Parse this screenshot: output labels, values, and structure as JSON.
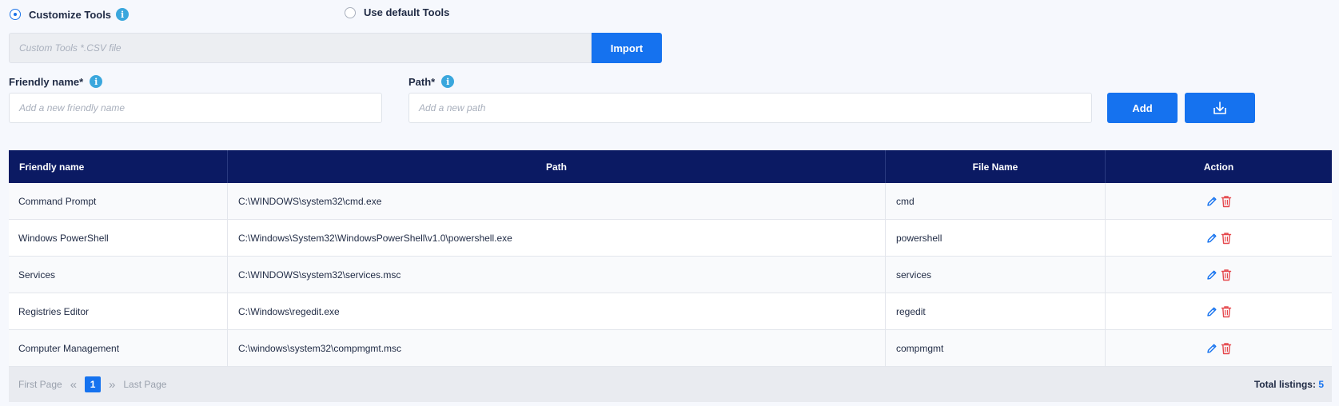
{
  "mode": {
    "customize_label": "Customize Tools",
    "default_label": "Use default Tools",
    "selected": "customize"
  },
  "import": {
    "placeholder": "Custom Tools *.CSV file",
    "button_label": "Import"
  },
  "form": {
    "friendly_label": "Friendly name*",
    "friendly_placeholder": "Add a new friendly name",
    "path_label": "Path*",
    "path_placeholder": "Add a new path",
    "add_label": "Add"
  },
  "table": {
    "headers": [
      "Friendly name",
      "Path",
      "File Name",
      "Action"
    ],
    "rows": [
      {
        "name": "Command Prompt",
        "path": "C:\\WINDOWS\\system32\\cmd.exe",
        "file": "cmd"
      },
      {
        "name": "Windows PowerShell",
        "path": "C:\\Windows\\System32\\WindowsPowerShell\\v1.0\\powershell.exe",
        "file": "powershell"
      },
      {
        "name": "Services",
        "path": "C:\\WINDOWS\\system32\\services.msc",
        "file": "services"
      },
      {
        "name": "Registries Editor",
        "path": "C:\\Windows\\regedit.exe",
        "file": "regedit"
      },
      {
        "name": "Computer Management",
        "path": "C:\\windows\\system32\\compmgmt.msc",
        "file": "compmgmt"
      }
    ]
  },
  "pager": {
    "first_label": "First Page",
    "current_page": "1",
    "last_label": "Last Page",
    "total_label": "Total listings:",
    "total_count": "5"
  },
  "colors": {
    "accent": "#1572ef",
    "header_bg": "#0b1a63",
    "delete": "#e5484d",
    "info": "#3aa7dd"
  },
  "icons": [
    "info-icon",
    "edit-icon",
    "trash-icon",
    "download-icon",
    "chevron-double-left-icon",
    "chevron-double-right-icon"
  ]
}
